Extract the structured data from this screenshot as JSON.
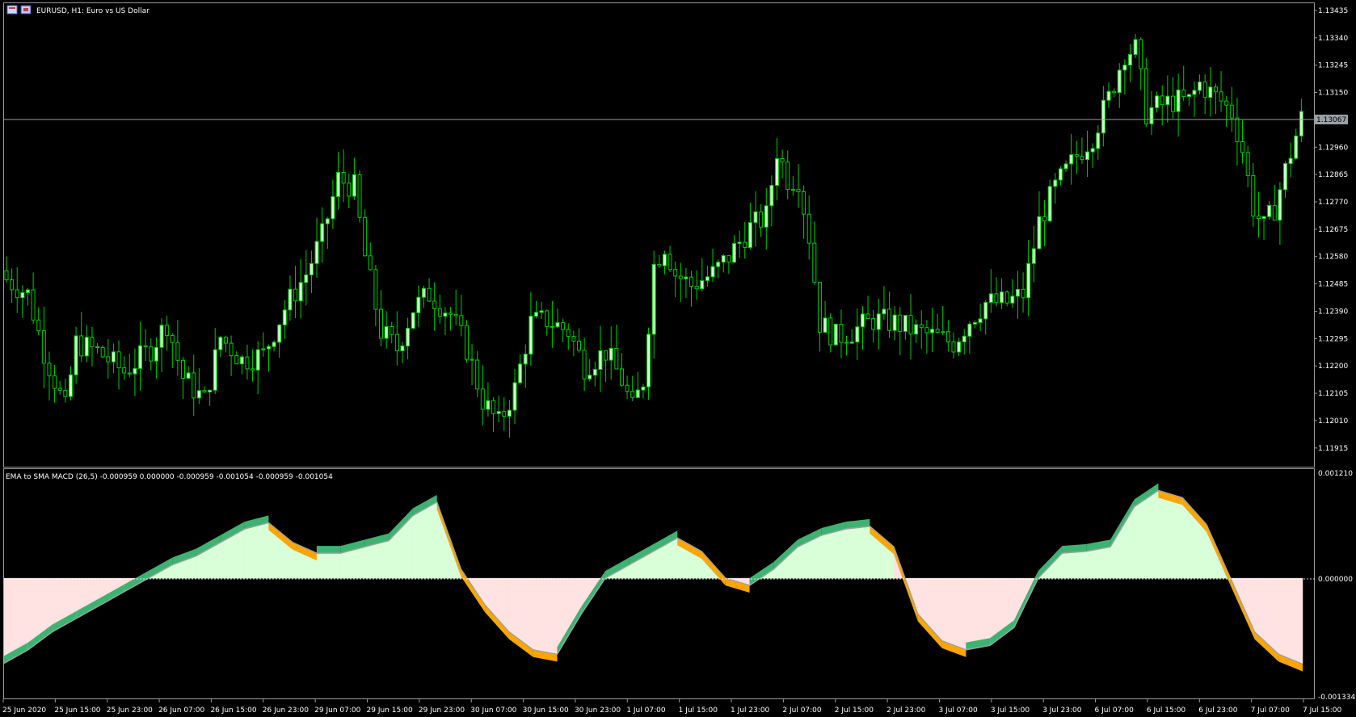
{
  "window": {
    "title": "EURUSD, H1:  Euro vs US Dollar",
    "current_price": "1.13067",
    "current_price_value": 1.13067
  },
  "indicator": {
    "label": "EMA to SMA MACD (26,5) -0.000959 0.000000 -0.000959 -0.001054 -0.000959 -0.001054",
    "ymax_label": "0.001210",
    "zero_label": "0.000000",
    "ymin_label": "-0.001334"
  },
  "colors": {
    "background": "#000000",
    "frame": "#9a9a9a",
    "bull_candle": "#ccffcc",
    "bear_candle": "#000000",
    "wick": "#00cc00",
    "current_price_line": "#9aa0a8",
    "histogram_positive": "#d8ffd8",
    "histogram_negative": "#ffe2e2",
    "signal_up": "#3cb371",
    "signal_down": "#ffa500",
    "macd_line": "#a0a0a0"
  },
  "chart_data": [
    {
      "type": "candlestick",
      "title": "EURUSD, H1:  Euro vs US Dollar",
      "ylim": [
        1.1185,
        1.1346
      ],
      "y_ticks": [
        "1.13435",
        "1.13340",
        "1.13245",
        "1.13150",
        "1.12960",
        "1.12865",
        "1.12770",
        "1.12675",
        "1.12580",
        "1.12485",
        "1.12390",
        "1.12295",
        "1.12200",
        "1.12105",
        "1.12010",
        "1.11915"
      ],
      "x_ticks": [
        "25 Jun 2020",
        "25 Jun 15:00",
        "25 Jun 23:00",
        "26 Jun 07:00",
        "26 Jun 15:00",
        "26 Jun 23:00",
        "29 Jun 07:00",
        "29 Jun 15:00",
        "29 Jun 23:00",
        "30 Jun 07:00",
        "30 Jun 15:00",
        "30 Jun 23:00",
        "1 Jul 07:00",
        "1 Jul 15:00",
        "1 Jul 23:00",
        "2 Jul 07:00",
        "2 Jul 15:00",
        "2 Jul 23:00",
        "3 Jul 07:00",
        "3 Jul 15:00",
        "3 Jul 23:00",
        "6 Jul 07:00",
        "6 Jul 15:00",
        "6 Jul 23:00",
        "7 Jul 07:00",
        "7 Jul 15:00"
      ],
      "anchors": [
        [
          0,
          1.125
        ],
        [
          4,
          1.1245
        ],
        [
          7,
          1.1225
        ],
        [
          9,
          1.1215
        ],
        [
          11,
          1.1205
        ],
        [
          13,
          1.1228
        ],
        [
          17,
          1.1225
        ],
        [
          22,
          1.1218
        ],
        [
          27,
          1.1226
        ],
        [
          30,
          1.1235
        ],
        [
          33,
          1.1216
        ],
        [
          37,
          1.1208
        ],
        [
          40,
          1.123
        ],
        [
          44,
          1.1222
        ],
        [
          48,
          1.1224
        ],
        [
          52,
          1.124
        ],
        [
          56,
          1.1252
        ],
        [
          59,
          1.1265
        ],
        [
          62,
          1.1285
        ],
        [
          65,
          1.1282
        ],
        [
          67,
          1.1258
        ],
        [
          70,
          1.1232
        ],
        [
          73,
          1.1226
        ],
        [
          76,
          1.124
        ],
        [
          79,
          1.1245
        ],
        [
          83,
          1.1238
        ],
        [
          86,
          1.1226
        ],
        [
          89,
          1.1208
        ],
        [
          92,
          1.12
        ],
        [
          95,
          1.1212
        ],
        [
          98,
          1.1235
        ],
        [
          101,
          1.1236
        ],
        [
          105,
          1.1232
        ],
        [
          108,
          1.122
        ],
        [
          112,
          1.1225
        ],
        [
          115,
          1.1215
        ],
        [
          117,
          1.1205
        ],
        [
          119,
          1.1215
        ],
        [
          121,
          1.1255
        ],
        [
          123,
          1.1262
        ],
        [
          125,
          1.1252
        ],
        [
          128,
          1.1248
        ],
        [
          132,
          1.1252
        ],
        [
          135,
          1.1258
        ],
        [
          139,
          1.1268
        ],
        [
          142,
          1.1272
        ],
        [
          144,
          1.1295
        ],
        [
          146,
          1.1285
        ],
        [
          148,
          1.1285
        ],
        [
          150,
          1.1265
        ],
        [
          152,
          1.1235
        ],
        [
          155,
          1.123
        ],
        [
          158,
          1.1232
        ],
        [
          162,
          1.1236
        ],
        [
          166,
          1.1235
        ],
        [
          170,
          1.1232
        ],
        [
          174,
          1.123
        ],
        [
          177,
          1.1228
        ],
        [
          180,
          1.1236
        ],
        [
          183,
          1.1242
        ],
        [
          187,
          1.1242
        ],
        [
          190,
          1.1245
        ],
        [
          193,
          1.127
        ],
        [
          196,
          1.1282
        ],
        [
          200,
          1.1293
        ],
        [
          203,
          1.13
        ],
        [
          206,
          1.1313
        ],
        [
          209,
          1.1329
        ],
        [
          211,
          1.133
        ],
        [
          213,
          1.1308
        ],
        [
          215,
          1.131
        ],
        [
          218,
          1.1312
        ],
        [
          221,
          1.1312
        ],
        [
          223,
          1.1318
        ],
        [
          225,
          1.1315
        ],
        [
          227,
          1.1312
        ],
        [
          229,
          1.1308
        ],
        [
          231,
          1.1295
        ],
        [
          233,
          1.1275
        ],
        [
          235,
          1.1268
        ],
        [
          237,
          1.1275
        ],
        [
          239,
          1.1288
        ],
        [
          241,
          1.13
        ],
        [
          242,
          1.1306
        ]
      ]
    },
    {
      "type": "area",
      "title": "EMA to SMA MACD (26,5)",
      "ylim": [
        -0.001334,
        0.00121
      ],
      "series": [
        {
          "name": "EMA to SMA MACD",
          "values": [
            -0.00095,
            -0.0008,
            -0.0006,
            -0.00045,
            -0.0003,
            -0.00015,
            0.0,
            0.00015,
            0.00025,
            0.0004,
            0.00055,
            0.00062,
            0.0004,
            0.00028,
            0.00028,
            0.00035,
            0.00042,
            0.0007,
            0.00085,
            0.0001,
            -0.0003,
            -0.0006,
            -0.0008,
            -0.00085,
            -0.0004,
            0.0,
            0.00015,
            0.0003,
            0.00045,
            0.0003,
            0.0,
            -8e-05,
            0.0001,
            0.00035,
            0.00048,
            0.00055,
            0.00058,
            0.00035,
            -0.0004,
            -0.0007,
            -0.0008,
            -0.00075,
            -0.00055,
            0.0,
            0.00028,
            0.0003,
            0.00035,
            0.0008,
            0.00098,
            0.0009,
            0.0006,
            0.0,
            -0.0006,
            -0.00085,
            -0.00096
          ]
        }
      ]
    }
  ]
}
